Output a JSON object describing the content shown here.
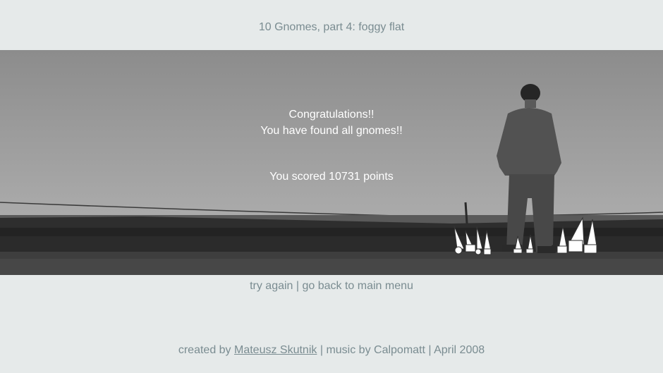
{
  "header": {
    "title": "10 Gnomes, part 4: foggy flat"
  },
  "scene": {
    "congrats_line1": "Congratulations!!",
    "congrats_line2": "You have found all gnomes!!",
    "score_text": "You scored 10731 points"
  },
  "links": {
    "try_again": "try again",
    "separator": " | ",
    "main_menu": "go back to main menu"
  },
  "credits": {
    "created_by": "created by ",
    "author": "Mateusz Skutnik",
    "music_part": " | music by Calpomatt | April 2008"
  },
  "colors": {
    "page_bg": "#e6eaea",
    "text_muted": "#7a8c91",
    "overlay_text": "#ffffff"
  }
}
